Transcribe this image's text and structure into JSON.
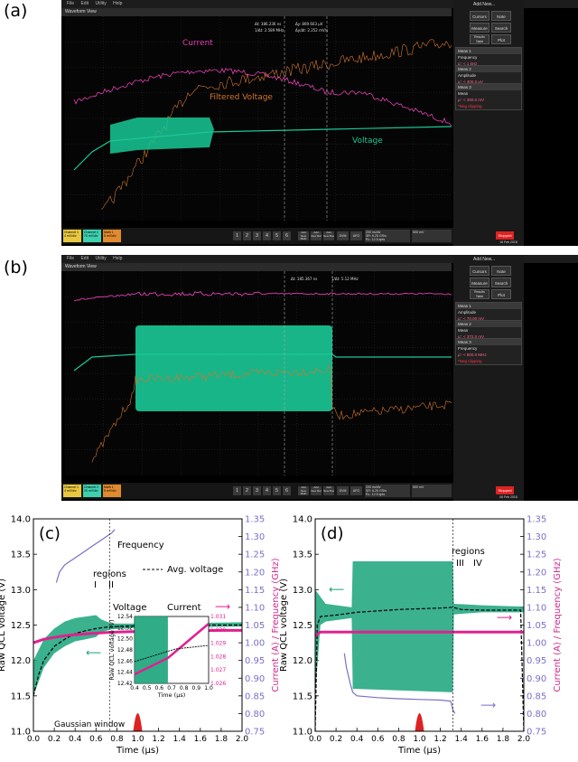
{
  "panel_labels": {
    "a": "(a)",
    "b": "(b)",
    "c": "(c)",
    "d": "(d)"
  },
  "scope": {
    "menu": [
      "File",
      "Edit",
      "Utility",
      "Help"
    ],
    "view_title": "Waveform View",
    "buttons": {
      "add_new": "Add New...",
      "cursors": "Cursors",
      "note": "Note",
      "measure": "Measure",
      "search": "Search",
      "results_table": "Results Table",
      "plot": "Plot",
      "stopped": "Stopped"
    },
    "multi_buttons": [
      "1",
      "2",
      "3",
      "4",
      "5",
      "6"
    ],
    "add_buttons": [
      "Add New Math",
      "Add New Ref",
      "Add New Bus"
    ],
    "dvm": "DVM",
    "afg": "AFG",
    "colors": {
      "magenta": "#e040b0",
      "green": "#19c997",
      "orange": "#d4762c"
    }
  },
  "scope_a": {
    "channels": [
      {
        "name": "Channel 1",
        "info": [
          "4 mV/div",
          "50 Ω",
          "500 MHz"
        ]
      },
      {
        "name": "Channel 2",
        "info": [
          "70 mV/div",
          "50 Ω",
          "1 GHz"
        ]
      },
      {
        "name": "Math 1",
        "info": [
          "5 mV/div",
          "2 Coeff/Pts..."
        ]
      }
    ],
    "horizontal": [
      "200 ns/div",
      "SR: 6.25 GS/s",
      "RL: 12.5 kpts",
      "2 µs",
      "160 ps/pt"
    ],
    "trigger": "500 mV",
    "acquisition": [
      "Manual,",
      "Analyze",
      "Sample: 8 bits",
      "Single: 1/1"
    ],
    "datetime": [
      "16 Feb 2018",
      "6:46:44 PM"
    ],
    "cursor_readouts": [
      "Δt: 386.236 ns",
      "Δy: 869.603 µV",
      "1/Δt: 2.589 MHz",
      "Δy/Δt: 2.252 mV/s"
    ],
    "measurements": [
      {
        "name": "Meas 1",
        "label": "Frequency",
        "value": "µ': < 1 kHz",
        "status": "*Neg clipping"
      },
      {
        "name": "Meas 2",
        "label": "Amplitude",
        "value": "µ': < 400.0 µV",
        "status": "*Neg clipping"
      },
      {
        "name": "Meas 3",
        "label": "Mean",
        "value": "µ': < 300.0 mV",
        "status": "*Neg clipping"
      }
    ],
    "trace_labels": {
      "current": "Current",
      "filtered": "Filtered Voltage",
      "voltage": "Voltage"
    }
  },
  "scope_b": {
    "channels": [
      {
        "name": "Channel 1",
        "info": [
          "4 mV/div",
          "50 Ω",
          "500 MHz"
        ]
      },
      {
        "name": "Channel 2",
        "info": [
          "20 mV/div",
          "50 Ω",
          "2 GHz"
        ]
      },
      {
        "name": "Math 1",
        "info": [
          "5 mV/div",
          "2 Coeff/Pts..."
        ]
      }
    ],
    "horizontal": [
      "200 ns/div",
      "SR: 6.25 GS/s",
      "RL: 12.5 kpts",
      "2 µs",
      "160 ps/pt"
    ],
    "trigger": "500 mV",
    "acquisition": [
      "Manual,",
      "Analyze",
      "Sample: 8 bits",
      "Single: 1/1"
    ],
    "datetime": [
      "06 Feb 2018",
      "1:56:37 PM"
    ],
    "cursor_readouts": [
      "Δt: 185.367 ns",
      "1/Δt: 5.12 MHz"
    ],
    "measurements": [
      {
        "name": "Meas 1",
        "label": "Amplitude",
        "value": "µ': < 70.00 mV",
        "status": "*Neg clipping"
      },
      {
        "name": "Meas 2",
        "label": "Mean",
        "value": "µ': < 372.0 mV",
        "status": "*Neg clipping"
      },
      {
        "name": "Meas 3",
        "label": "Frequency",
        "value": "µ': < 800.0 MHz",
        "status": "*Neg clipping"
      }
    ]
  },
  "chart_data": [
    {
      "panel": "(c)",
      "type": "line",
      "xlabel": "Time (µs)",
      "ylabel": "Raw QCL voltage (V)",
      "y2label": "Current (A) / Frequency (GHz)",
      "xlim": [
        0.0,
        2.0
      ],
      "ylim": [
        11.0,
        14.0
      ],
      "y2lim": [
        0.75,
        1.35
      ],
      "xticks": [
        "0.0",
        "0.2",
        "0.4",
        "0.6",
        "0.8",
        "1.0",
        "1.2",
        "1.4",
        "1.6",
        "1.8",
        "2.0"
      ],
      "yticks": [
        "11.0",
        "11.5",
        "12.0",
        "12.5",
        "13.0",
        "13.5",
        "14.0"
      ],
      "y2ticks": [
        "0.75",
        "0.80",
        "0.85",
        "0.90",
        "0.95",
        "1.00",
        "1.05",
        "1.10",
        "1.15",
        "1.20",
        "1.25",
        "1.30",
        "1.35"
      ],
      "annotations": {
        "frequency": "Frequency",
        "regions": "regions",
        "region_i": "I",
        "region_ii": "II",
        "avg_voltage": "Avg. voltage",
        "voltage": "Voltage",
        "current": "Current",
        "gaussian": "Gaussian window"
      },
      "region_boundary_us": 0.73,
      "series": [
        {
          "name": "Voltage",
          "color": "#19a37a",
          "envelope": {
            "x": [
              0.0,
              0.1,
              0.2,
              0.3,
              0.4,
              0.5,
              0.6,
              0.65,
              0.75,
              1.0,
              1.5,
              2.0
            ],
            "lower": [
              11.5,
              11.9,
              12.1,
              12.2,
              12.27,
              12.3,
              12.33,
              12.4,
              12.44,
              12.46,
              12.47,
              12.48
            ],
            "upper": [
              12.0,
              12.3,
              12.45,
              12.55,
              12.6,
              12.62,
              12.64,
              12.58,
              12.52,
              12.52,
              12.53,
              12.54
            ]
          }
        },
        {
          "name": "Avg. voltage",
          "color": "#000000",
          "x": [
            0.0,
            0.05,
            0.1,
            0.2,
            0.3,
            0.4,
            0.5,
            0.6,
            0.7,
            0.8,
            1.0,
            1.2,
            1.4,
            1.6,
            1.8,
            2.0
          ],
          "y": [
            11.5,
            11.8,
            12.0,
            12.2,
            12.3,
            12.38,
            12.42,
            12.45,
            12.47,
            12.48,
            12.49,
            12.49,
            12.5,
            12.5,
            12.5,
            12.5
          ]
        },
        {
          "name": "Current",
          "color": "#e0208f",
          "axis": "y2",
          "x": [
            0.0,
            0.1,
            0.2,
            0.3,
            0.4,
            0.5,
            0.6,
            0.7,
            0.8,
            1.0,
            1.2,
            1.4,
            1.6,
            1.8,
            2.0
          ],
          "y": [
            1.0,
            1.01,
            1.015,
            1.02,
            1.023,
            1.025,
            1.027,
            1.029,
            1.03,
            1.032,
            1.033,
            1.034,
            1.034,
            1.035,
            1.035
          ]
        },
        {
          "name": "Frequency",
          "color": "#7a6ec9",
          "axis": "y2",
          "x": [
            0.22,
            0.25,
            0.3,
            0.35,
            0.4,
            0.45,
            0.5,
            0.55,
            0.6,
            0.65,
            0.7,
            0.75,
            0.78
          ],
          "y": [
            1.17,
            1.2,
            1.22,
            1.23,
            1.24,
            1.25,
            1.26,
            1.27,
            1.28,
            1.29,
            1.3,
            1.31,
            1.32
          ]
        }
      ],
      "inset": {
        "xlabel": "Time (µs)",
        "ylabel": "Raw QCL voltage (V)",
        "xlim": [
          0.4,
          1.0
        ],
        "ylim": [
          12.42,
          12.54
        ],
        "y2lim": [
          1.026,
          1.031
        ],
        "xticks": [
          "0.4",
          "0.5",
          "0.6",
          "0.7",
          "0.8",
          "0.9",
          "1.0"
        ],
        "yticks": [
          "12.42",
          "12.44",
          "12.46",
          "12.48",
          "12.50",
          "12.52",
          "12.54"
        ],
        "y2ticks": [
          "1.026",
          "1.027",
          "1.028",
          "1.029",
          "1.030",
          "1.031"
        ]
      }
    },
    {
      "panel": "(d)",
      "type": "line",
      "xlabel": "Time (µs)",
      "ylabel": "Raw QCL voltage (V)",
      "y2label": "Current (A) / Frequency (GHz)",
      "xlim": [
        0.0,
        2.0
      ],
      "ylim": [
        11.0,
        14.0
      ],
      "y2lim": [
        0.75,
        1.35
      ],
      "xticks": [
        "0.0",
        "0.2",
        "0.4",
        "0.6",
        "0.8",
        "1.0",
        "1.2",
        "1.4",
        "1.6",
        "1.8",
        "2.0"
      ],
      "yticks": [
        "11.0",
        "11.5",
        "12.0",
        "12.5",
        "13.0",
        "13.5",
        "14.0"
      ],
      "y2ticks": [
        "0.75",
        "0.80",
        "0.85",
        "0.90",
        "0.95",
        "1.00",
        "1.05",
        "1.10",
        "1.15",
        "1.20",
        "1.25",
        "1.30",
        "1.35"
      ],
      "annotations": {
        "regions": "regions",
        "region_iii": "III",
        "region_iv": "IV"
      },
      "region_boundary_us": 1.32,
      "series": [
        {
          "name": "Voltage",
          "color": "#19a37a",
          "envelope": {
            "x": [
              0.0,
              0.05,
              0.1,
              0.35,
              0.36,
              1.32,
              1.33,
              1.6,
              2.0
            ],
            "lower": [
              11.5,
              12.5,
              12.55,
              12.6,
              11.6,
              11.55,
              12.65,
              12.68,
              12.68
            ],
            "upper": [
              13.0,
              12.9,
              12.8,
              12.75,
              13.4,
              13.4,
              12.8,
              12.78,
              12.76
            ]
          }
        },
        {
          "name": "Avg. voltage",
          "color": "#000000",
          "x": [
            0.0,
            0.02,
            0.05,
            0.2,
            0.4,
            0.6,
            0.8,
            1.0,
            1.2,
            1.32,
            1.4,
            1.6,
            1.8,
            1.97,
            2.0
          ],
          "y": [
            11.0,
            12.5,
            12.62,
            12.64,
            12.68,
            12.7,
            12.72,
            12.73,
            12.74,
            12.75,
            12.72,
            12.71,
            12.71,
            12.71,
            11.0
          ]
        },
        {
          "name": "Current",
          "color": "#e0208f",
          "axis": "y2",
          "x": [
            0.0,
            0.05,
            0.2,
            0.5,
            1.0,
            1.5,
            2.0
          ],
          "y": [
            1.02,
            1.03,
            1.03,
            1.03,
            1.03,
            1.03,
            1.03
          ]
        },
        {
          "name": "Frequency",
          "color": "#7a6ec9",
          "axis": "y2",
          "x": [
            0.28,
            0.3,
            0.34,
            0.36,
            0.4,
            0.6,
            0.8,
            1.0,
            1.2,
            1.3,
            1.32,
            1.34
          ],
          "y": [
            0.97,
            0.93,
            0.88,
            0.86,
            0.85,
            0.845,
            0.842,
            0.84,
            0.838,
            0.835,
            0.81,
            0.8
          ]
        }
      ]
    }
  ]
}
